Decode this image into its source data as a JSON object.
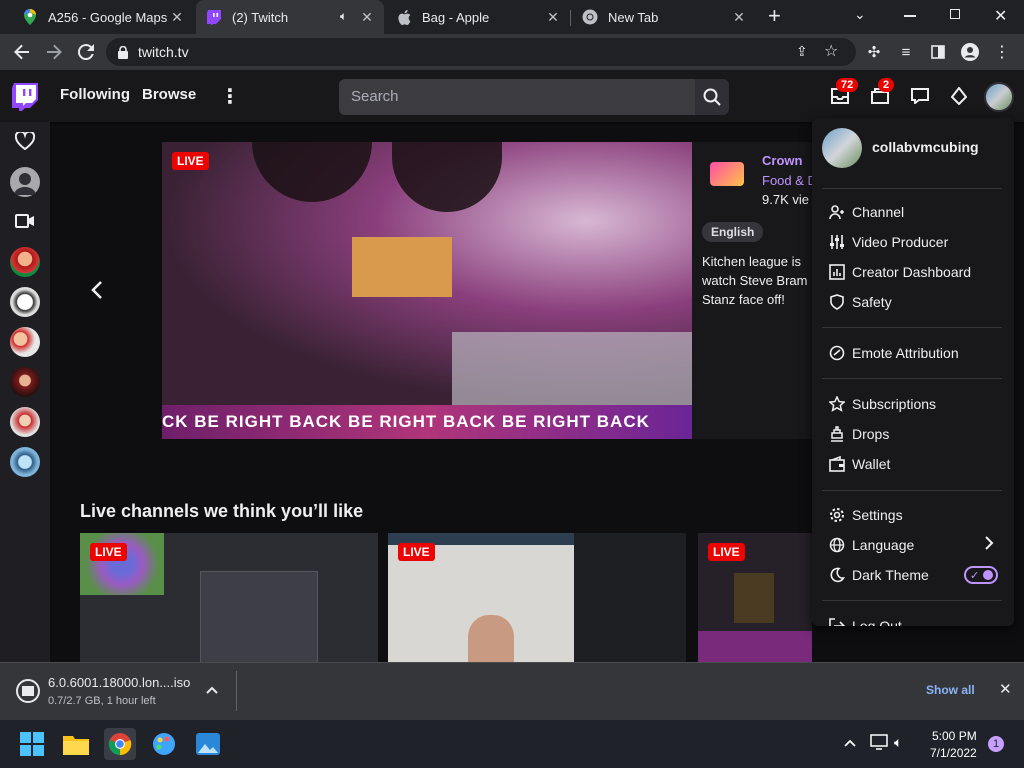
{
  "browser": {
    "tabs": [
      {
        "title": "A256 - Google Maps"
      },
      {
        "title": "(2) Twitch"
      },
      {
        "title": "Bag - Apple"
      },
      {
        "title": "New Tab"
      }
    ],
    "new_tab_symbol": "+",
    "url": "twitch.tv"
  },
  "twitch": {
    "nav": {
      "following": "Following",
      "browse": "Browse"
    },
    "search_placeholder": "Search",
    "badges": {
      "inbox": "72",
      "whispers": "2"
    },
    "hero": {
      "live": "LIVE",
      "brb": "CK    BE RIGHT BACK    BE RIGHT BACK    BE RIGHT BACK",
      "channel": "Crown",
      "category": "Food & D",
      "viewers": "9.7K vie",
      "tag": "English",
      "description": "Kitchen league is watch Steve Bram Stanz face off!"
    },
    "section_title": "Live channels we think you’ll like",
    "thumbs_live": "LIVE",
    "menu": {
      "username": "collabvmcubing",
      "items": [
        "Channel",
        "Video Producer",
        "Creator Dashboard",
        "Safety",
        "Emote Attribution",
        "Subscriptions",
        "Drops",
        "Wallet",
        "Settings",
        "Language",
        "Dark Theme",
        "Log Out"
      ]
    }
  },
  "downloads": {
    "filename": "6.0.6001.18000.lon....iso",
    "progress": "0.7/2.7 GB, 1 hour left",
    "show_all": "Show all"
  },
  "taskbar": {
    "time": "5:00 PM",
    "date": "7/1/2022",
    "notifications": "1"
  },
  "colors": {
    "twitch_purple": "#9147ff",
    "live_red": "#eb0400",
    "chrome_dark": "#202124"
  }
}
